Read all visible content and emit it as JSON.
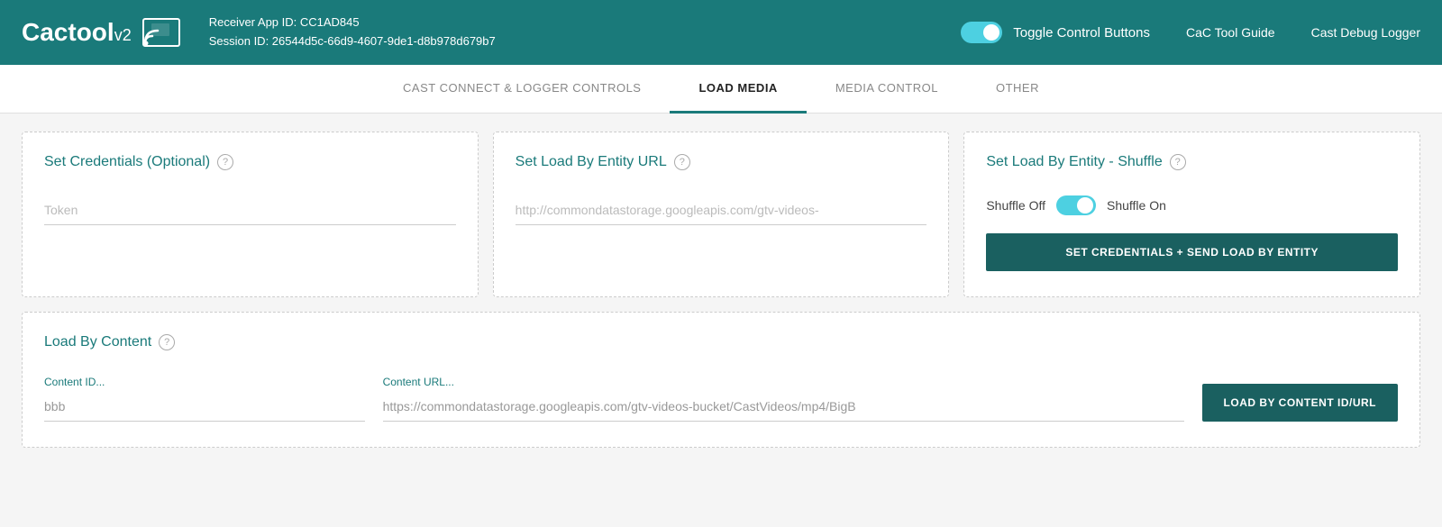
{
  "header": {
    "logo_text": "Cactool",
    "logo_version": "v2",
    "receiver_app_id_label": "Receiver App ID: CC1AD845",
    "session_id_label": "Session ID: 26544d5c-66d9-4607-9de1-d8b978d679b7",
    "toggle_label": "Toggle Control Buttons",
    "nav_guide": "CaC Tool Guide",
    "nav_logger": "Cast Debug Logger"
  },
  "tabs": [
    {
      "label": "CAST CONNECT & LOGGER CONTROLS",
      "active": false
    },
    {
      "label": "LOAD MEDIA",
      "active": true
    },
    {
      "label": "MEDIA CONTROL",
      "active": false
    },
    {
      "label": "OTHER",
      "active": false
    }
  ],
  "load_media": {
    "set_credentials": {
      "title": "Set Credentials (Optional)",
      "token_placeholder": "Token"
    },
    "set_load_by_entity_url": {
      "title": "Set Load By Entity URL",
      "url_placeholder": "http://commondatastorage.googleapis.com/gtv-videos-"
    },
    "set_load_by_entity_shuffle": {
      "title": "Set Load By Entity - Shuffle",
      "shuffle_off_label": "Shuffle Off",
      "shuffle_on_label": "Shuffle On",
      "button_label": "SET CREDENTIALS + SEND LOAD BY ENTITY"
    },
    "load_by_content": {
      "title": "Load By Content",
      "content_id_label": "Content ID...",
      "content_id_value": "bbb",
      "content_url_label": "Content URL...",
      "content_url_value": "https://commondatastorage.googleapis.com/gtv-videos-bucket/CastVideos/mp4/BigB",
      "button_label": "LOAD BY CONTENT ID/URL"
    }
  },
  "icons": {
    "help": "?",
    "cast": "📺"
  },
  "colors": {
    "teal": "#1a7a7a",
    "dark_teal": "#1a6060",
    "toggle_blue": "#4dd0e1"
  }
}
